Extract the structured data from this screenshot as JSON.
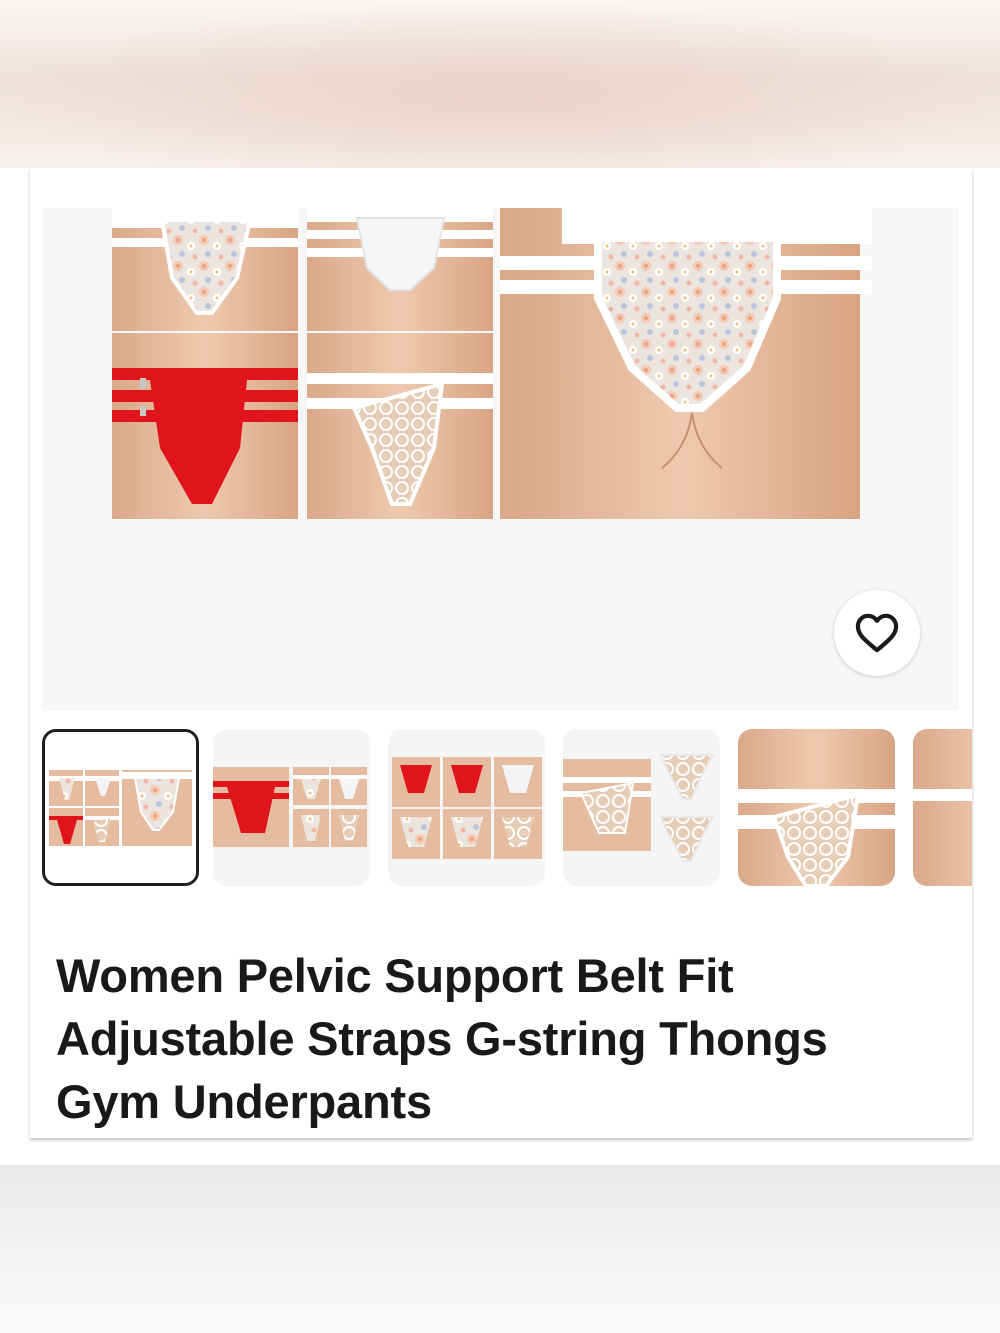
{
  "listing": {
    "title": "Women Pelvic Support Belt Fit Adjustable Straps G-string Thongs Gym Underpants"
  },
  "gallery": {
    "thumbnail_count_visible": 6,
    "selected_index": 0,
    "favorite_icon": "heart-outline-icon"
  },
  "colors": {
    "strap_white": "#ffffff",
    "red_variant": "#e0141b",
    "skin": "#e8bfa3",
    "selected_border": "#1f1f1f"
  }
}
